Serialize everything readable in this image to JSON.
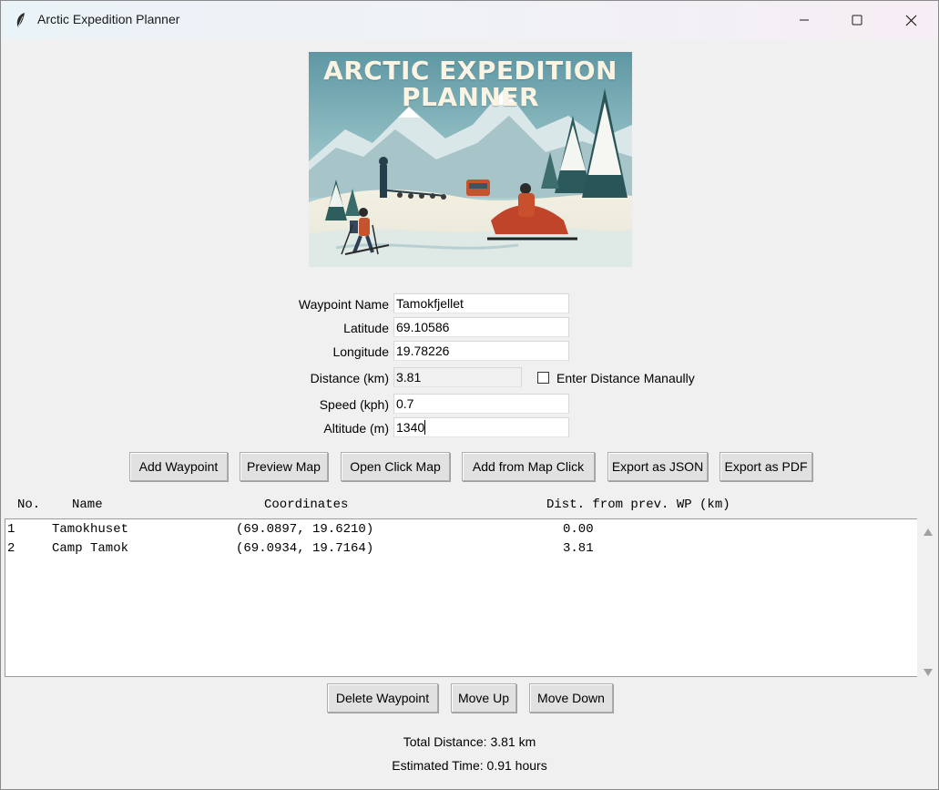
{
  "window": {
    "title": "Arctic Expedition Planner",
    "controls": [
      "minimize",
      "maximize",
      "close"
    ]
  },
  "banner": {
    "title_line1": "ARCTIC EXPEDITION",
    "title_line2": "PLANNER"
  },
  "form": {
    "waypoint_name_label": "Waypoint Name",
    "waypoint_name_value": "Tamokfjellet",
    "latitude_label": "Latitude",
    "latitude_value": "69.10586",
    "longitude_label": "Longitude",
    "longitude_value": "19.78226",
    "distance_label": "Distance (km)",
    "distance_value": "3.81",
    "manual_distance_label": "Enter Distance Manaully",
    "manual_distance_checked": false,
    "speed_label": "Speed (kph)",
    "speed_value": "0.7",
    "altitude_label": "Altitude (m)",
    "altitude_value": "1340"
  },
  "toolbar": {
    "add_waypoint": "Add Waypoint",
    "preview_map": "Preview Map",
    "open_click_map": "Open Click Map",
    "add_from_map_click": "Add from Map Click",
    "export_json": "Export as JSON",
    "export_pdf": "Export as PDF"
  },
  "table": {
    "headers": {
      "no": "No.",
      "name": "Name",
      "coordinates": "Coordinates",
      "distance": "Dist. from prev. WP (km)"
    },
    "rows": [
      {
        "no": "1",
        "name": "Tamokhuset",
        "coords": "(69.0897, 19.6210)",
        "dist": "0.00"
      },
      {
        "no": "2",
        "name": "Camp Tamok",
        "coords": "(69.0934, 19.7164)",
        "dist": "3.81"
      }
    ]
  },
  "list_actions": {
    "delete": "Delete Waypoint",
    "move_up": "Move Up",
    "move_down": "Move Down"
  },
  "summary": {
    "total_distance": "Total Distance: 3.81 km",
    "estimated_time": "Estimated Time: 0.91 hours"
  },
  "icons": {
    "app": "feather-icon",
    "minimize": "minimize-icon",
    "maximize": "maximize-icon",
    "close": "close-icon",
    "scroll_up": "scroll-up-icon",
    "scroll_down": "scroll-down-icon"
  }
}
